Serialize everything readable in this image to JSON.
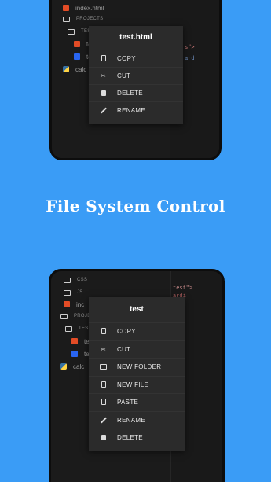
{
  "headline": "File System Control",
  "colors": {
    "background": "#3a9cf6",
    "phone_frame": "#0d0d0d",
    "menu_background": "#2b2b2b",
    "html_icon": "#e34c26",
    "css_icon": "#2965f1"
  },
  "top_screen": {
    "tree": [
      "index.html",
      "PROJECTS",
      "TEST",
      "te",
      "te",
      "calc"
    ],
    "code": {
      "line1": "s\">",
      "line2": "ard"
    },
    "menu": {
      "title": "test.html",
      "items": [
        {
          "label": "COPY",
          "icon": "copy-icon"
        },
        {
          "label": "CUT",
          "icon": "scissors-icon"
        },
        {
          "label": "DELETE",
          "icon": "trash-icon"
        },
        {
          "label": "RENAME",
          "icon": "pencil-icon"
        }
      ]
    }
  },
  "bottom_screen": {
    "tree": [
      "CSS",
      "JS",
      "inc",
      "PROJE",
      "TES",
      "te",
      "te",
      "calc"
    ],
    "code": {
      "line1": "test\">",
      "line2": "ardi",
      "line3": "c>"
    },
    "menu": {
      "title": "test",
      "items": [
        {
          "label": "COPY",
          "icon": "copy-icon"
        },
        {
          "label": "CUT",
          "icon": "scissors-icon"
        },
        {
          "label": "NEW FOLDER",
          "icon": "new-folder-icon"
        },
        {
          "label": "NEW FILE",
          "icon": "new-file-icon"
        },
        {
          "label": "PASTE",
          "icon": "paste-icon"
        },
        {
          "label": "RENAME",
          "icon": "pencil-icon"
        },
        {
          "label": "DELETE",
          "icon": "trash-icon"
        }
      ]
    }
  }
}
